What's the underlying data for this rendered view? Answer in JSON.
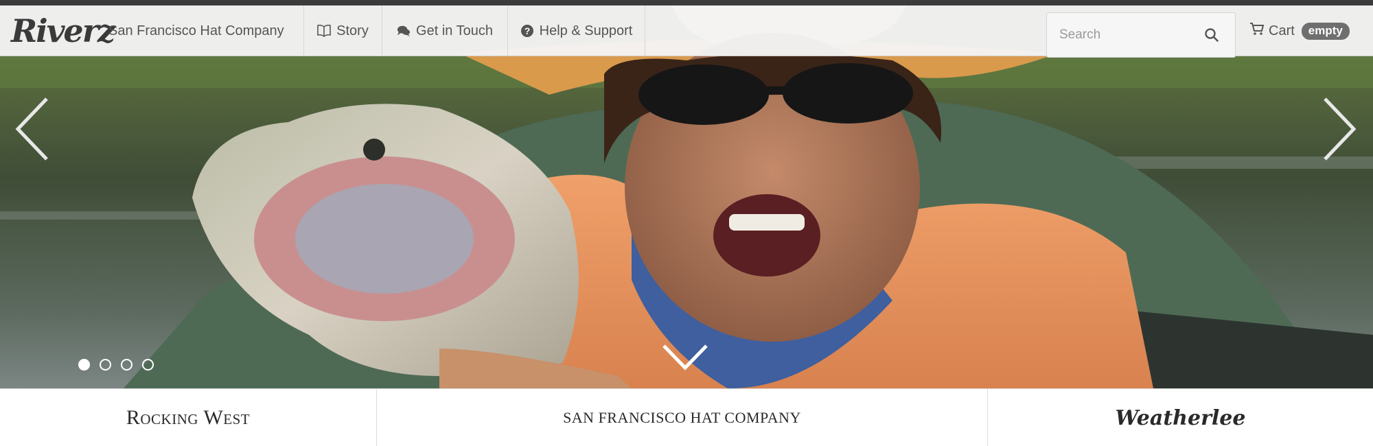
{
  "navbar": {
    "logo_text": "Riverz",
    "tagline": "San Francisco Hat Company",
    "items": [
      {
        "label": "Story",
        "icon": "book-icon"
      },
      {
        "label": "Get in Touch",
        "icon": "chat-bubbles-icon"
      },
      {
        "label": "Help & Support",
        "icon": "question-circle-icon"
      }
    ],
    "search": {
      "placeholder": "Search",
      "value": ""
    },
    "cart": {
      "label": "Cart",
      "badge": "empty",
      "icon": "shopping-cart-icon"
    }
  },
  "carousel": {
    "slide_count": 4,
    "active_index": 0,
    "prev_icon": "chevron-left-icon",
    "next_icon": "chevron-right-icon",
    "scroll_icon": "chevron-down-icon"
  },
  "brands": [
    {
      "label": "Rocking West"
    },
    {
      "label": "San Francisco Hat Company"
    },
    {
      "label": "Weatherlee"
    }
  ],
  "colors": {
    "navbar_bg": "#f4f4f4",
    "text": "#555555",
    "badge_bg": "#6f6f6f",
    "shirt": "#e8925a",
    "water": "#4c5d46"
  }
}
